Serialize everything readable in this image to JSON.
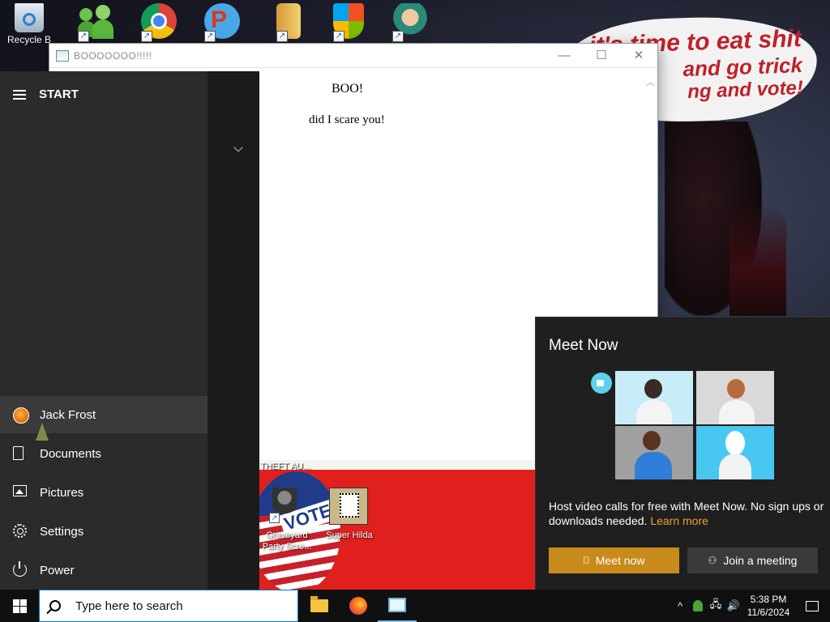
{
  "desktop": {
    "icons": [
      {
        "name": "recycle-bin",
        "label": "Recycle B"
      },
      {
        "name": "messenger",
        "label": ""
      },
      {
        "name": "chrome",
        "label": ""
      },
      {
        "name": "powerpoint",
        "label": ""
      },
      {
        "name": "door-app",
        "label": ""
      },
      {
        "name": "windows-app",
        "label": ""
      },
      {
        "name": "character-app",
        "label": ""
      }
    ],
    "wallpaper_text": {
      "line1": "it's time to eat shit",
      "line2": "and go trick",
      "line3": "ng and vote!"
    },
    "red_panel": {
      "theft_label": "THEFT AU...",
      "vote_text": "VOTE",
      "graveyard_label_line1": "Graveyard",
      "graveyard_label_line2": "Party Scre...",
      "hilda_label": "Super Hilda"
    }
  },
  "popup": {
    "title": "BOOOOOOO!!!!!",
    "minimize": "—",
    "maximize": "☐",
    "close": "✕",
    "heading": "BOO!",
    "body": "did I scare you!"
  },
  "start_menu": {
    "title": "START",
    "user": "Jack Frost",
    "items": [
      {
        "label": "Documents"
      },
      {
        "label": "Pictures"
      },
      {
        "label": "Settings"
      },
      {
        "label": "Power"
      }
    ]
  },
  "meet_now": {
    "title": "Meet Now",
    "description": "Host video calls for free with Meet Now. No sign ups or downloads needed.",
    "link": "Learn more",
    "primary_button": "Meet now",
    "secondary_button": "Join a meeting",
    "accent": "#c88a1a"
  },
  "taskbar": {
    "search_placeholder": "Type here to search",
    "time": "5:38 PM",
    "date": "11/6/2024",
    "tray": {
      "chevron": "^",
      "network": "🖧",
      "volume": "🔊"
    }
  }
}
